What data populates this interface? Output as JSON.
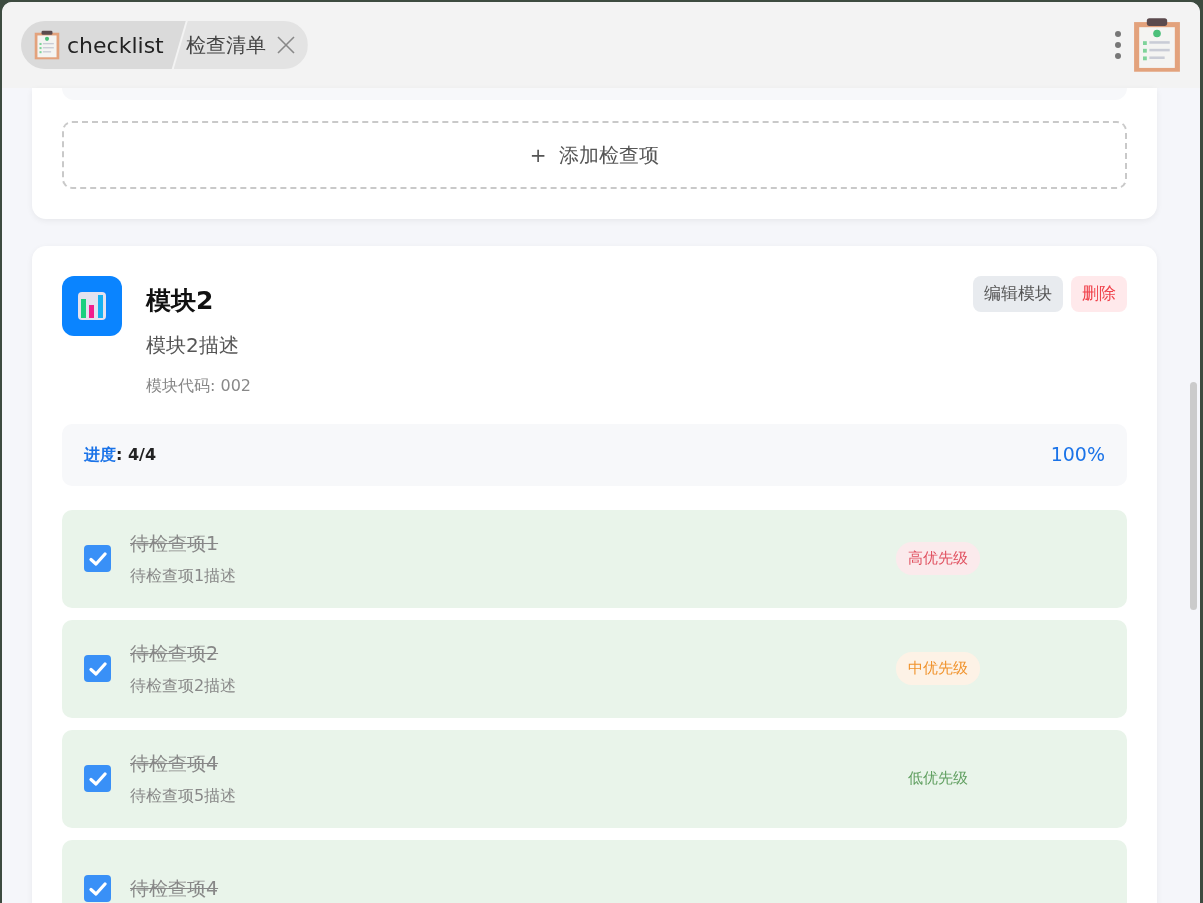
{
  "titlebar": {
    "app_name": "checklist",
    "tab": {
      "label": "检查清单"
    }
  },
  "top_module": {
    "add_button": "+  添加检查项"
  },
  "module": {
    "title": "模块2",
    "description": "模块2描述",
    "code": "模块代码: 002",
    "edit_button": "编辑模块",
    "delete_button": "删除",
    "progress": {
      "label": "进度",
      "count": ": 4/4",
      "percent": "100%"
    },
    "items": [
      {
        "title": "待检查项1",
        "description": "待检查项1描述",
        "checked": true,
        "priority": {
          "kind": "pill",
          "label": "高优先级",
          "color": "#e0505f"
        }
      },
      {
        "title": "待检查项2",
        "description": "待检查项2描述",
        "checked": true,
        "priority": {
          "kind": "pill",
          "label": "中优先级",
          "color": "#f0922b"
        }
      },
      {
        "title": "待检查项4",
        "description": "待检查项5描述",
        "checked": true,
        "priority": {
          "kind": "plain",
          "label": "低优先级",
          "color": "#5f9e5f"
        }
      },
      {
        "title": "待检查项4",
        "checked": true
      }
    ]
  }
}
